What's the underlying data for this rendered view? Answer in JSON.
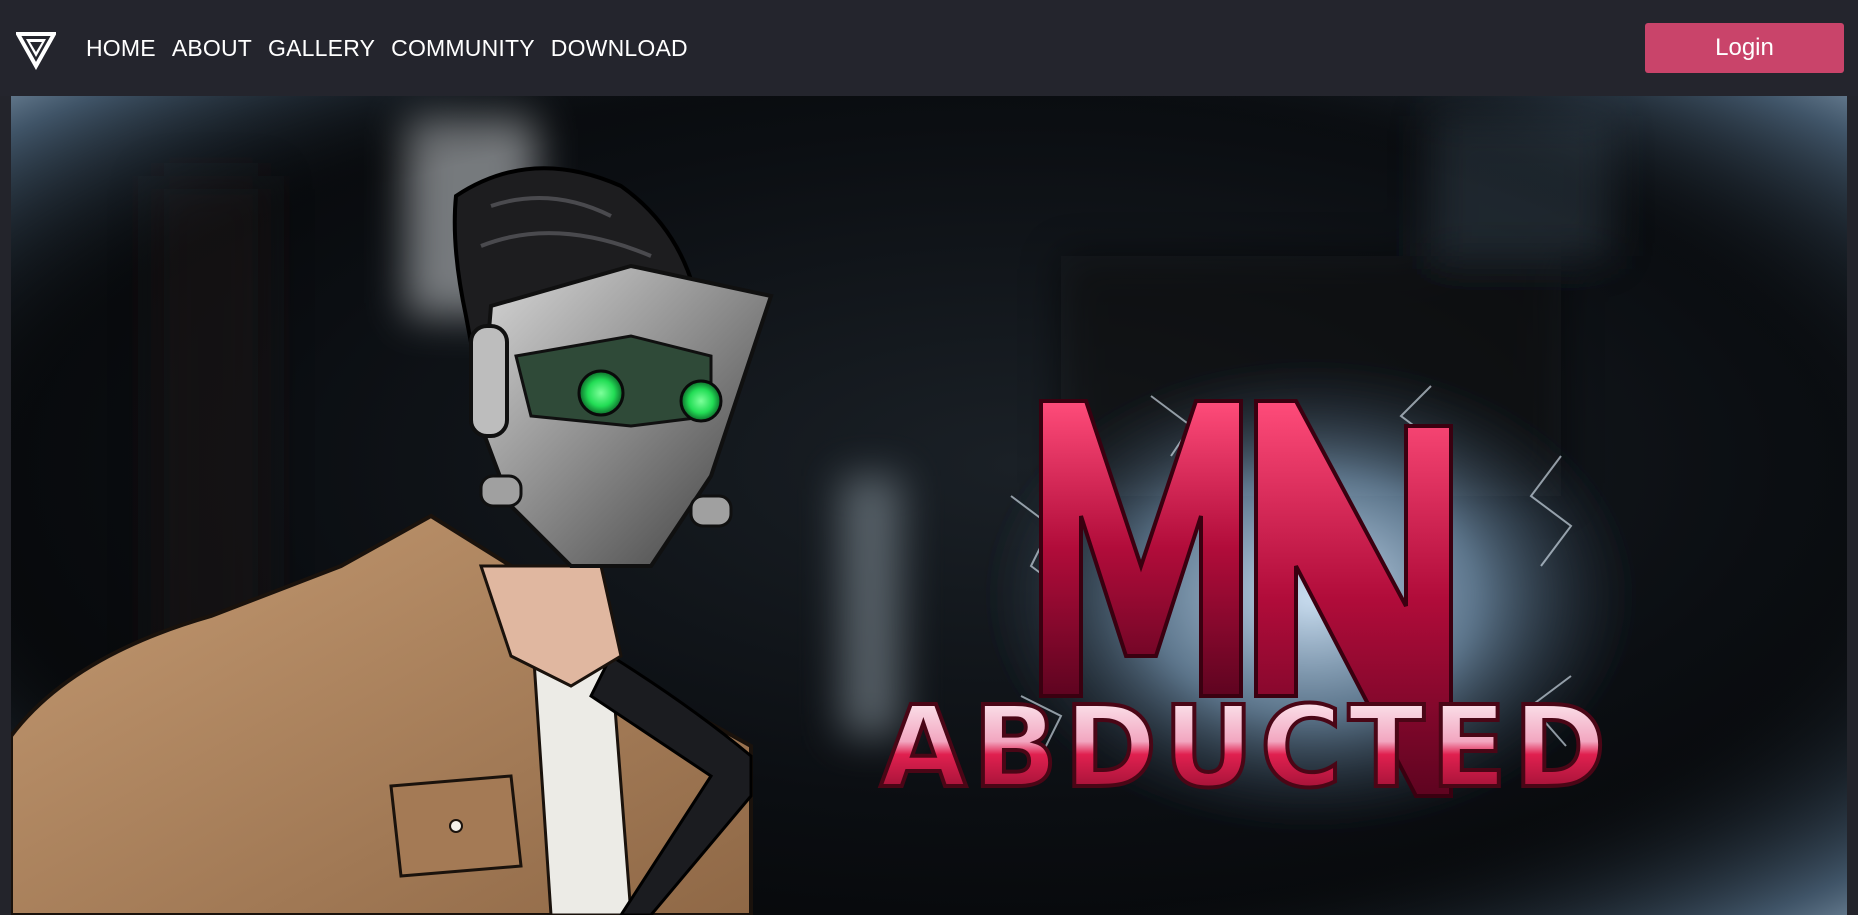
{
  "nav": {
    "logo_icon": "triangle-logo-icon",
    "links": [
      {
        "label": "HOME"
      },
      {
        "label": "ABOUT"
      },
      {
        "label": "GALLERY"
      },
      {
        "label": "COMMUNITY"
      },
      {
        "label": "DOWNLOAD"
      }
    ],
    "login_label": "Login"
  },
  "hero": {
    "logo_top": "MN",
    "logo_bottom": "ABDUCTED",
    "colors": {
      "accent": "#c9446a",
      "logo_red": "#c01040",
      "eye_green": "#22dd55",
      "jacket": "#b08660"
    }
  }
}
